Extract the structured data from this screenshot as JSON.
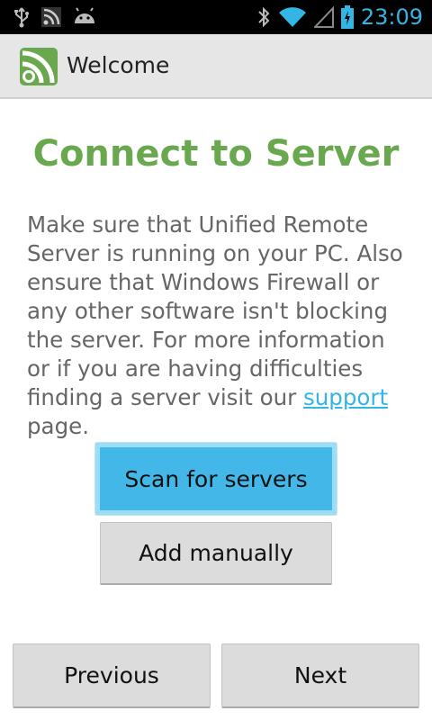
{
  "status_bar": {
    "time": "23:09",
    "icons_left": [
      "usb-icon",
      "rss-notification-icon",
      "android-icon"
    ],
    "icons_right": [
      "bluetooth-icon",
      "wifi-icon",
      "signal-icon",
      "battery-charging-icon"
    ]
  },
  "action_bar": {
    "title": "Welcome",
    "icon": "app-logo-icon"
  },
  "main": {
    "heading": "Connect to Server",
    "body_before_link": "Make sure that Unified Remote Server is running on your PC. Also ensure that Windows Firewall or any other software isn't blocking the server. For more information or if you are having difficulties finding a server visit our ",
    "link_text": "support",
    "body_after_link": " page.",
    "scan_button": "Scan for servers",
    "add_button": "Add manually"
  },
  "footer": {
    "previous_button": "Previous",
    "next_button": "Next"
  },
  "colors": {
    "accent_green": "#6aa84f",
    "accent_blue": "#33b5e5",
    "scan_button": "#43b8e8"
  }
}
